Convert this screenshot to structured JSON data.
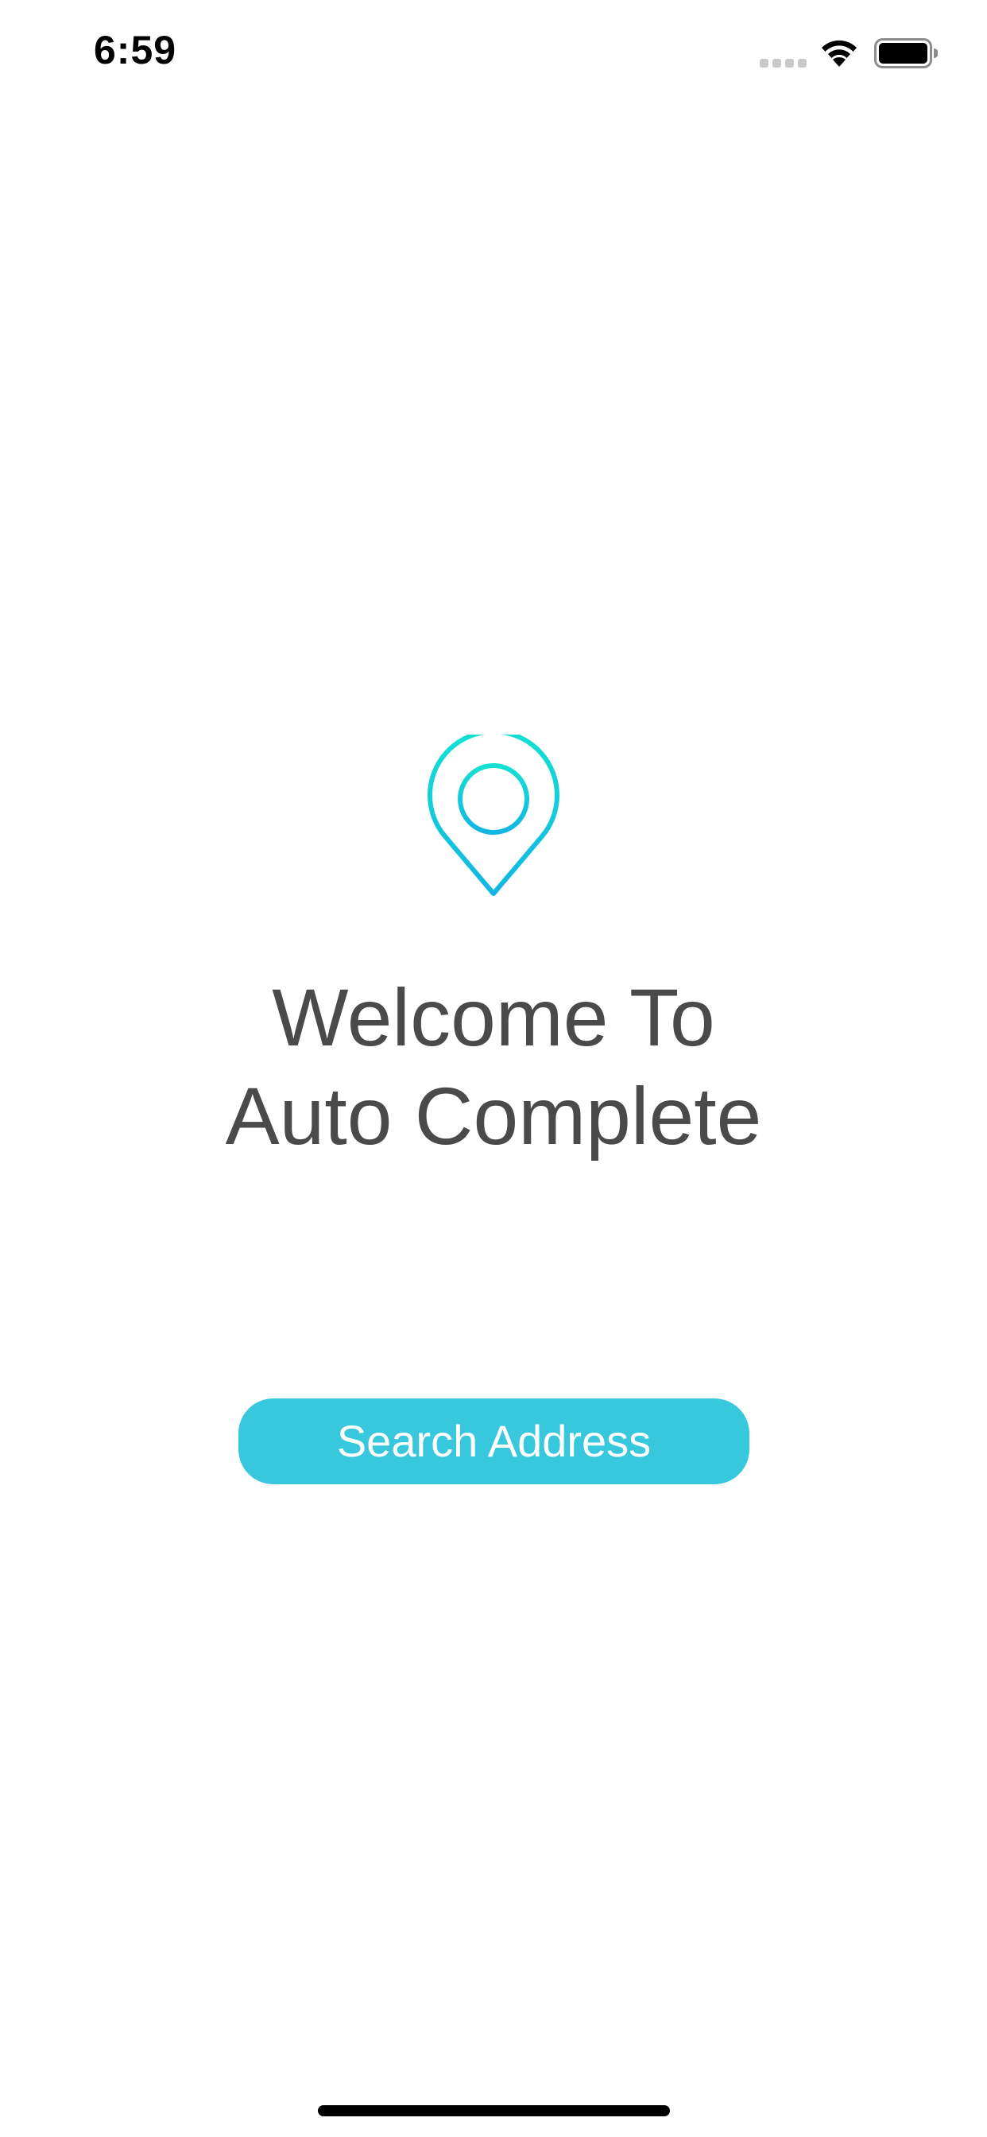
{
  "status_bar": {
    "time": "6:59",
    "signal_icon": "cellular-signal-dots-icon",
    "wifi_icon": "wifi-icon",
    "battery_icon": "battery-full-icon"
  },
  "hero": {
    "icon": "location-pin-icon",
    "icon_color_top": "#15e0d2",
    "icon_color_bottom": "#12b6e4",
    "title_line1": "Welcome To",
    "title_line2": "Auto Complete",
    "title_color": "#4a4a4a"
  },
  "actions": {
    "search_label": "Search Address",
    "button_color": "#38c8de"
  }
}
